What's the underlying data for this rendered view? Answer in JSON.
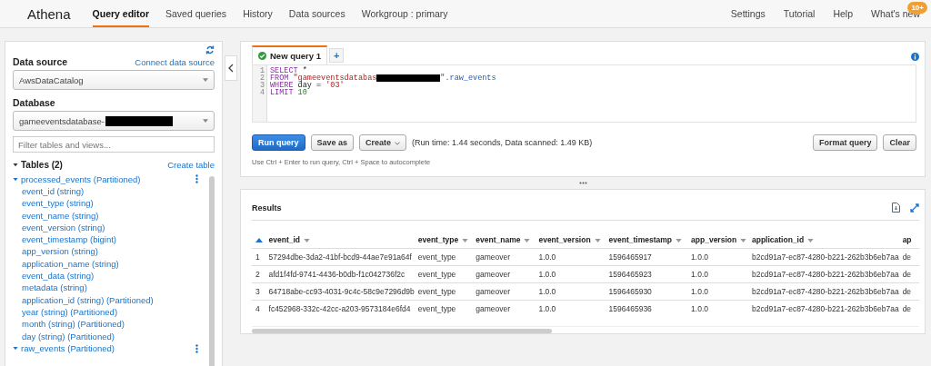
{
  "nav": {
    "brand": "Athena",
    "tabs": [
      {
        "label": "Query editor",
        "selected": true
      },
      {
        "label": "Saved queries",
        "selected": false
      },
      {
        "label": "History",
        "selected": false
      },
      {
        "label": "Data sources",
        "selected": false
      },
      {
        "label": "Workgroup : primary",
        "selected": false
      }
    ],
    "right": [
      {
        "label": "Settings"
      },
      {
        "label": "Tutorial"
      },
      {
        "label": "Help"
      },
      {
        "label": "What's new",
        "badge": "10+"
      }
    ]
  },
  "sidebar": {
    "data_source_label": "Data source",
    "connect_link": "Connect data source",
    "data_source": "AwsDataCatalog",
    "database_label": "Database",
    "database": "gameeventsdatabase-",
    "database_redacted": true,
    "filter_placeholder": "Filter tables and views...",
    "tables_heading": "Tables (2)",
    "tables_expanded": true,
    "create_link": "Create table",
    "tables": [
      {
        "name": "processed_events (Partitioned)",
        "expanded": true,
        "children": [
          {
            "name": "event_id (string)"
          },
          {
            "name": "event_type (string)"
          },
          {
            "name": "event_name (string)"
          },
          {
            "name": "event_version (string)"
          },
          {
            "name": "event_timestamp (bigint)"
          },
          {
            "name": "app_version (string)"
          },
          {
            "name": "application_name (string)"
          },
          {
            "name": "event_data (string)"
          },
          {
            "name": "metadata (string)"
          },
          {
            "name": "application_id (string) (Partitioned)"
          },
          {
            "name": "year (string) (Partitioned)"
          },
          {
            "name": "month (string) (Partitioned)"
          },
          {
            "name": "day (string) (Partitioned)"
          }
        ]
      },
      {
        "name": "raw_events (Partitioned)",
        "expanded": true
      }
    ]
  },
  "editor": {
    "tabs": [
      {
        "label": "New query 1",
        "selected": true
      }
    ],
    "add_tab": "+",
    "lines": [
      {
        "number": "1",
        "tokens": [
          {
            "kind": "keyword",
            "text": "SELECT"
          },
          {
            "kind": "plain",
            "text": " *"
          }
        ]
      },
      {
        "number": "2",
        "tokens": [
          {
            "kind": "keyword",
            "text": "FROM "
          },
          {
            "kind": "string",
            "text": "\"gameeventsdatabas"
          },
          {
            "kind": "redacted"
          },
          {
            "kind": "string",
            "text": "\""
          },
          {
            "kind": "ident",
            "text": ".raw_events"
          }
        ]
      },
      {
        "number": "3",
        "tokens": [
          {
            "kind": "keyword",
            "text": "WHERE"
          },
          {
            "kind": "plain",
            "text": " day = "
          },
          {
            "kind": "string",
            "text": "'03'"
          }
        ]
      },
      {
        "number": "4",
        "tokens": [
          {
            "kind": "keyword",
            "text": "LIMIT "
          },
          {
            "kind": "number",
            "text": "10"
          }
        ]
      }
    ],
    "buttons": [
      {
        "label": "Run query",
        "kind": "primary"
      },
      {
        "label": "Save as",
        "kind": "plain"
      },
      {
        "label": "Create",
        "kind": "dropdown"
      }
    ],
    "run_info": "(Run time: 1.44 seconds, Data scanned: 1.49 KB)",
    "right_buttons": [
      {
        "label": "Format query"
      },
      {
        "label": "Clear"
      }
    ],
    "hint": "Use Ctrl + Enter to run query, Ctrl + Space to autocomplete"
  },
  "results": {
    "title": "Results",
    "columns": [
      {
        "label": "event_id"
      },
      {
        "label": "event_type"
      },
      {
        "label": "event_name"
      },
      {
        "label": "event_version"
      },
      {
        "label": "event_timestamp"
      },
      {
        "label": "app_version"
      },
      {
        "label": "application_id"
      },
      {
        "label": "ap"
      }
    ],
    "rows": [
      {
        "index": "1",
        "cells": [
          "57294dbe-3da2-41bf-bcd9-44ae7e91a64f",
          "event_type",
          "gameover",
          "1.0.0",
          "1596465917",
          "1.0.0",
          "b2cd91a7-ec87-4280-b221-262b3b6eb7aa",
          "de"
        ]
      },
      {
        "index": "2",
        "cells": [
          "afd1f4fd-9741-4436-b0db-f1c042736f2c",
          "event_type",
          "gameover",
          "1.0.0",
          "1596465923",
          "1.0.0",
          "b2cd91a7-ec87-4280-b221-262b3b6eb7aa",
          "de"
        ]
      },
      {
        "index": "3",
        "cells": [
          "64718abe-cc93-4031-9c4c-58c9e7296d9b",
          "event_type",
          "gameover",
          "1.0.0",
          "1596465930",
          "1.0.0",
          "b2cd91a7-ec87-4280-b221-262b3b6eb7aa",
          "de"
        ]
      },
      {
        "index": "4",
        "cells": [
          "fc452968-332c-42cc-a203-9573184e6fd4",
          "event_type",
          "gameover",
          "1.0.0",
          "1596465936",
          "1.0.0",
          "b2cd91a7-ec87-4280-b221-262b3b6eb7aa",
          "de"
        ]
      }
    ]
  }
}
